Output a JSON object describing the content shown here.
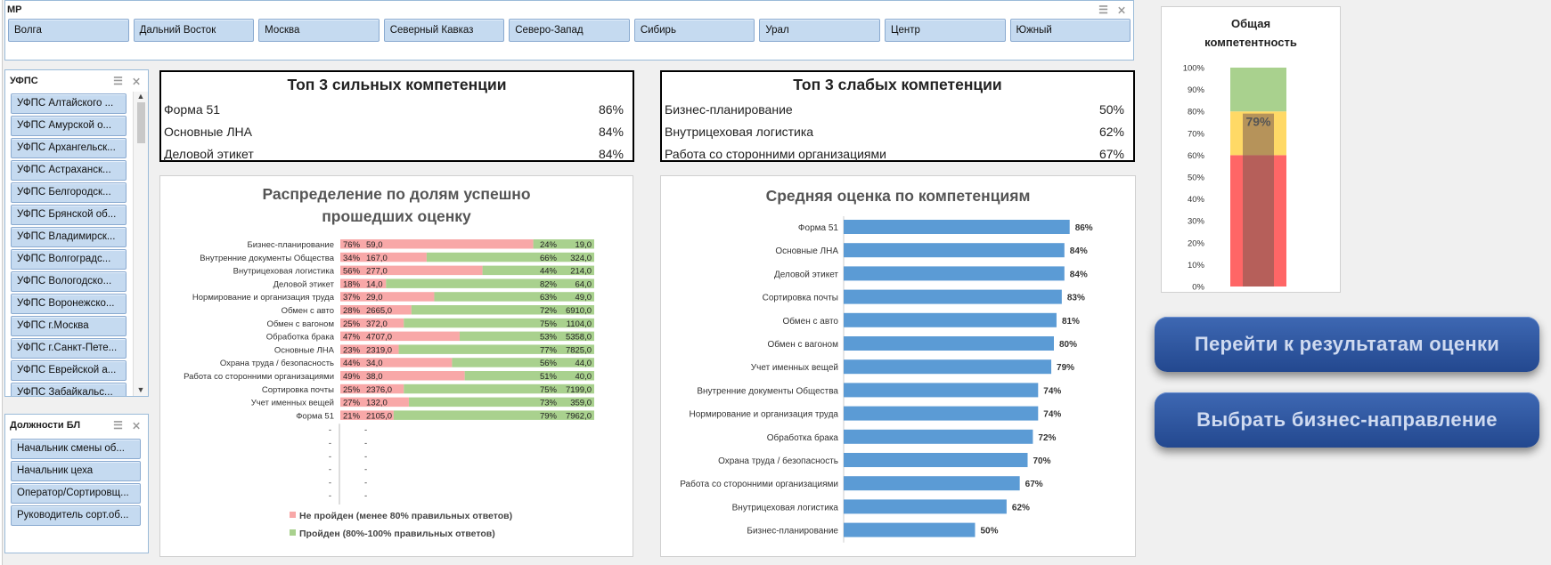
{
  "mp_slicer": {
    "title": "МР",
    "items": [
      "Волга",
      "Дальний Восток",
      "Москва",
      "Северный Кавказ",
      "Северо-Запад",
      "Сибирь",
      "Урал",
      "Центр",
      "Южный"
    ]
  },
  "ufps_slicer": {
    "title": "УФПС",
    "items": [
      "УФПС Алтайского ...",
      "УФПС Амурской о...",
      "УФПС Архангельск...",
      "УФПС Астраханск...",
      "УФПС Белгородск...",
      "УФПС Брянской об...",
      "УФПС Владимирск...",
      "УФПС Волгоградс...",
      "УФПС Вологодско...",
      "УФПС Воронежско...",
      "УФПС г.Москва",
      "УФПС г.Санкт-Пете...",
      "УФПС Еврейской а...",
      "УФПС Забайкальс..."
    ]
  },
  "dolzh_slicer": {
    "title": "Должности БЛ",
    "items": [
      "Начальник смены об...",
      "Начальник цеха",
      "Оператор/Сортировщ...",
      "Руководитель сорт.об..."
    ]
  },
  "top_strong": {
    "title": "Топ 3 сильных компетенции",
    "rows": [
      {
        "name": "Форма 51",
        "value": "86%"
      },
      {
        "name": "Основные ЛНА",
        "value": "84%"
      },
      {
        "name": "Деловой этикет",
        "value": "84%"
      }
    ]
  },
  "top_weak": {
    "title": "Топ 3 слабых компетенции",
    "rows": [
      {
        "name": "Бизнес-планирование",
        "value": "50%"
      },
      {
        "name": "Внутрицеховая логистика",
        "value": "62%"
      },
      {
        "name": "Работа со сторонними организациями",
        "value": "67%"
      }
    ]
  },
  "nav_buttons": {
    "results": "Перейти к результатам оценки",
    "direction": "Выбрать бизнес-направление"
  },
  "chart_data": [
    {
      "type": "bar",
      "stacked": true,
      "orientation": "horizontal",
      "title_line1": "Распределение по долям успешно",
      "title_line2": "прошедших оценку",
      "categories": [
        "Бизнес-планирование",
        "Внутренние документы Общества",
        "Внутрицеховая логистика",
        "Деловой этикет",
        "Нормирование и организация труда",
        "Обмен с авто",
        "Обмен с вагоном",
        "Обработка брака",
        "Основные ЛНА",
        "Охрана труда / безопасность",
        "Работа со сторонними организациями",
        "Сортировка почты",
        "Учет именных вещей",
        "Форма 51"
      ],
      "series": [
        {
          "name": "Не пройден (менее 80% правильных ответов)",
          "color": "#f8a8a8",
          "pct": [
            76,
            34,
            56,
            18,
            37,
            28,
            25,
            47,
            23,
            44,
            49,
            25,
            27,
            21
          ],
          "pct_labels": [
            "76%",
            "34%",
            "56%",
            "18%",
            "37%",
            "28%",
            "25%",
            "47%",
            "23%",
            "44%",
            "49%",
            "25%",
            "27%",
            "21%"
          ],
          "counts": [
            "59,0",
            "167,0",
            "277,0",
            "14,0",
            "29,0",
            "2665,0",
            "372,0",
            "4707,0",
            "2319,0",
            "34,0",
            "38,0",
            "2376,0",
            "132,0",
            "2105,0"
          ]
        },
        {
          "name": "Пройден (80%-100% правильных ответов)",
          "color": "#a9d18e",
          "pct_labels": [
            "24%",
            "66%",
            "44%",
            "82%",
            "63%",
            "72%",
            "75%",
            "53%",
            "77%",
            "56%",
            "51%",
            "75%",
            "73%",
            "79%"
          ],
          "counts": [
            "19,0",
            "324,0",
            "214,0",
            "64,0",
            "49,0",
            "6910,0",
            "1104,0",
            "5358,0",
            "7825,0",
            "44,0",
            "40,0",
            "7199,0",
            "359,0",
            "7962,0"
          ]
        }
      ],
      "empty_rows": 6,
      "empty_label": "-"
    },
    {
      "type": "bar",
      "orientation": "horizontal",
      "title": "Средняя оценка по компетенциям",
      "color": "#5b9bd5",
      "categories": [
        "Форма 51",
        "Основные ЛНА",
        "Деловой этикет",
        "Сортировка почты",
        "Обмен с авто",
        "Обмен с вагоном",
        "Учет именных вещей",
        "Внутренние документы Общества",
        "Нормирование и организация труда",
        "Обработка брака",
        "Охрана труда / безопасность",
        "Работа со сторонними организациями",
        "Внутрицеховая логистика",
        "Бизнес-планирование"
      ],
      "values": [
        86,
        84,
        84,
        83,
        81,
        80,
        79,
        74,
        74,
        72,
        70,
        67,
        62,
        50
      ],
      "value_labels": [
        "86%",
        "84%",
        "84%",
        "83%",
        "81%",
        "80%",
        "79%",
        "74%",
        "74%",
        "72%",
        "70%",
        "67%",
        "62%",
        "50%"
      ]
    },
    {
      "type": "bar",
      "title_line1": "Общая",
      "title_line2": "компетентность",
      "value": 79,
      "value_label": "79%",
      "ylim": [
        0,
        100
      ],
      "ticks": [
        "0%",
        "10%",
        "20%",
        "30%",
        "40%",
        "50%",
        "60%",
        "70%",
        "80%",
        "90%",
        "100%"
      ],
      "bands": [
        {
          "from": 0,
          "to": 60,
          "color": "#ff6666"
        },
        {
          "from": 60,
          "to": 80,
          "color": "#ffd966"
        },
        {
          "from": 80,
          "to": 100,
          "color": "#a9d18e"
        }
      ],
      "value_color": "#7a5a50"
    }
  ]
}
